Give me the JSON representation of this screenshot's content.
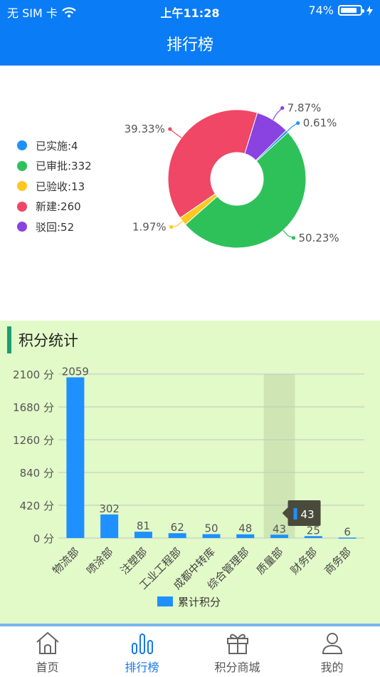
{
  "status_bar": {
    "carrier": "无 SIM 卡",
    "time": "上午11:28",
    "battery": "74%",
    "battery_level": 0.74
  },
  "nav": {
    "title": "排行榜"
  },
  "pie_chart": {
    "legend": [
      {
        "label": "已实施:4",
        "color": "#1e90ff"
      },
      {
        "label": "已审批:332",
        "color": "#2ec15a"
      },
      {
        "label": "已验收:13",
        "color": "#ffc820"
      },
      {
        "label": "新建:260",
        "color": "#ef4765"
      },
      {
        "label": "驳回:52",
        "color": "#8a42e0"
      }
    ]
  },
  "points": {
    "title": "积分统计",
    "legend_label": "累计积分",
    "tooltip_value": "43"
  },
  "chart_data": [
    {
      "type": "pie",
      "variant": "donut",
      "slices": [
        {
          "name": "已实施",
          "value": 4,
          "label": "0.61%",
          "color": "#1e90ff"
        },
        {
          "name": "已审批",
          "value": 332,
          "label": "50.23%",
          "color": "#2ec15a"
        },
        {
          "name": "已验收",
          "value": 13,
          "label": "1.97%",
          "color": "#ffc820"
        },
        {
          "name": "新建",
          "value": 260,
          "label": "39.33%",
          "color": "#ef4765"
        },
        {
          "name": "驳回",
          "value": 52,
          "label": "7.87%",
          "color": "#8a42e0"
        }
      ],
      "legend_position": "left"
    },
    {
      "type": "bar",
      "categories": [
        "物流部",
        "喷涂部",
        "注塑部",
        "工业工程部",
        "成都中转库",
        "综合管理部",
        "质量部",
        "财务部",
        "商务部"
      ],
      "values": [
        2059,
        302,
        81,
        62,
        50,
        48,
        43,
        25,
        6
      ],
      "series": [
        {
          "name": "累计积分",
          "values": [
            2059,
            302,
            81,
            62,
            50,
            48,
            43,
            25,
            6
          ],
          "color": "#1e90ff"
        }
      ],
      "yticks": [
        "0 分",
        "420 分",
        "840 分",
        "1260 分",
        "1680 分",
        "2100 分"
      ],
      "ylim": [
        0,
        2100
      ],
      "highlighted_category": "质量部",
      "grid": true,
      "legend_position": "bottom"
    }
  ],
  "tabs": [
    {
      "label": "首页",
      "icon": "home-icon",
      "active": false
    },
    {
      "label": "排行榜",
      "icon": "bar-chart-icon",
      "active": true
    },
    {
      "label": "积分商城",
      "icon": "gift-icon",
      "active": false
    },
    {
      "label": "我的",
      "icon": "user-icon",
      "active": false
    }
  ]
}
